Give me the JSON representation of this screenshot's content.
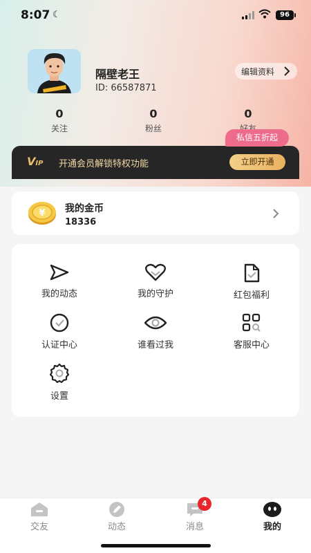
{
  "status": {
    "time": "8:07",
    "battery": "96"
  },
  "profile": {
    "name": "隔壁老王",
    "id": "ID: 66587871",
    "edit_label": "编辑资料"
  },
  "stats": [
    {
      "num": "0",
      "label": "关注"
    },
    {
      "num": "0",
      "label": "粉丝"
    },
    {
      "num": "0",
      "label": "好友"
    }
  ],
  "vip": {
    "logo": "V",
    "logo_sub": "IP",
    "text": "开通会员解锁特权功能",
    "button": "立即开通",
    "promo": "私信五折起"
  },
  "coins": {
    "title": "我的金币",
    "value": "18336"
  },
  "menu": [
    {
      "label": "我的动态",
      "icon": "send-icon"
    },
    {
      "label": "我的守护",
      "icon": "heart-icon"
    },
    {
      "label": "红包福利",
      "icon": "document-icon"
    },
    {
      "label": "认证中心",
      "icon": "check-circle-icon"
    },
    {
      "label": "谁看过我",
      "icon": "eye-icon"
    },
    {
      "label": "客服中心",
      "icon": "service-grid-icon"
    },
    {
      "label": "设置",
      "icon": "gear-icon"
    }
  ],
  "tabs": [
    {
      "label": "交友",
      "icon": "home-icon"
    },
    {
      "label": "动态",
      "icon": "pencil-icon"
    },
    {
      "label": "消息",
      "icon": "chat-icon",
      "badge": "4"
    },
    {
      "label": "我的",
      "icon": "profile-face-icon",
      "active": true
    }
  ],
  "colors": {
    "accent_gold": "#e8b25e",
    "promo_pink": "#ef6b8c",
    "badge_red": "#e8262c",
    "vip_dark": "#272626"
  }
}
